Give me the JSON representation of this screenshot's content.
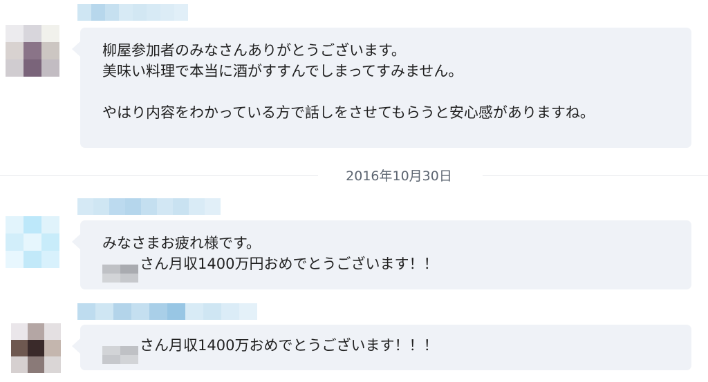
{
  "messages": [
    {
      "lines": [
        "柳屋参加者のみなさんありがとうございます。",
        "美味い料理で本当に酒がすすんでしまってすみません。",
        "",
        "やはり内容をわかっている方で話しをさせてもらうと安心感がありますね。"
      ]
    },
    {
      "lines": [
        "みなさまお疲れ様です。",
        "さん月収1400万円おめでとうございます！！"
      ]
    },
    {
      "lines": [
        "さん月収1400万おめでとうございます！！！"
      ]
    }
  ],
  "date_separator": "2016年10月30日",
  "mosaic_colors": {
    "avatar1": [
      "#ecebee",
      "#d8d6dc",
      "#f1f1ec",
      "#d8d2d0",
      "#8a7488",
      "#ccc6c2",
      "#d0ccd0",
      "#7a647a",
      "#c2bcc2"
    ],
    "name1": [
      "#cfe6f3",
      "#b7d7ec",
      "#c6e0f0",
      "#d7eaf5",
      "#d2e7f3",
      "#d7eaf5",
      "#dcecf6",
      "#e1eff8"
    ],
    "avatar2": [
      "#e2f4fc",
      "#bde8fa",
      "#e0f3fb",
      "#d2eefa",
      "#e6f6fd",
      "#c8ecfa",
      "#e8f7fe",
      "#c2e9f9",
      "#d8f1fc"
    ],
    "name2": [
      "#d5e9f5",
      "#cfe6f3",
      "#bcdaef",
      "#b5d6ec",
      "#c4dff0",
      "#d2e7f4",
      "#c9e2f1",
      "#d9ebf6",
      "#e1eff8"
    ],
    "avatar3": [
      "#eae6ea",
      "#b4a6a4",
      "#e4e0e2",
      "#6e5850",
      "#3a2a2a",
      "#c4b6ae",
      "#d6d0d0",
      "#8a7a78",
      "#dad6d6"
    ],
    "name3": [
      "#bedcef",
      "#cfe6f3",
      "#b3d4ea",
      "#c4dff0",
      "#a9cfe8",
      "#98c6e4",
      "#d8ebf6",
      "#cfe6f3",
      "#dbecf7",
      "#e4f1f9"
    ],
    "redact": [
      "#bfc1c5",
      "#a9abb0",
      "#d2d4d7",
      "#c6c8cc"
    ]
  }
}
